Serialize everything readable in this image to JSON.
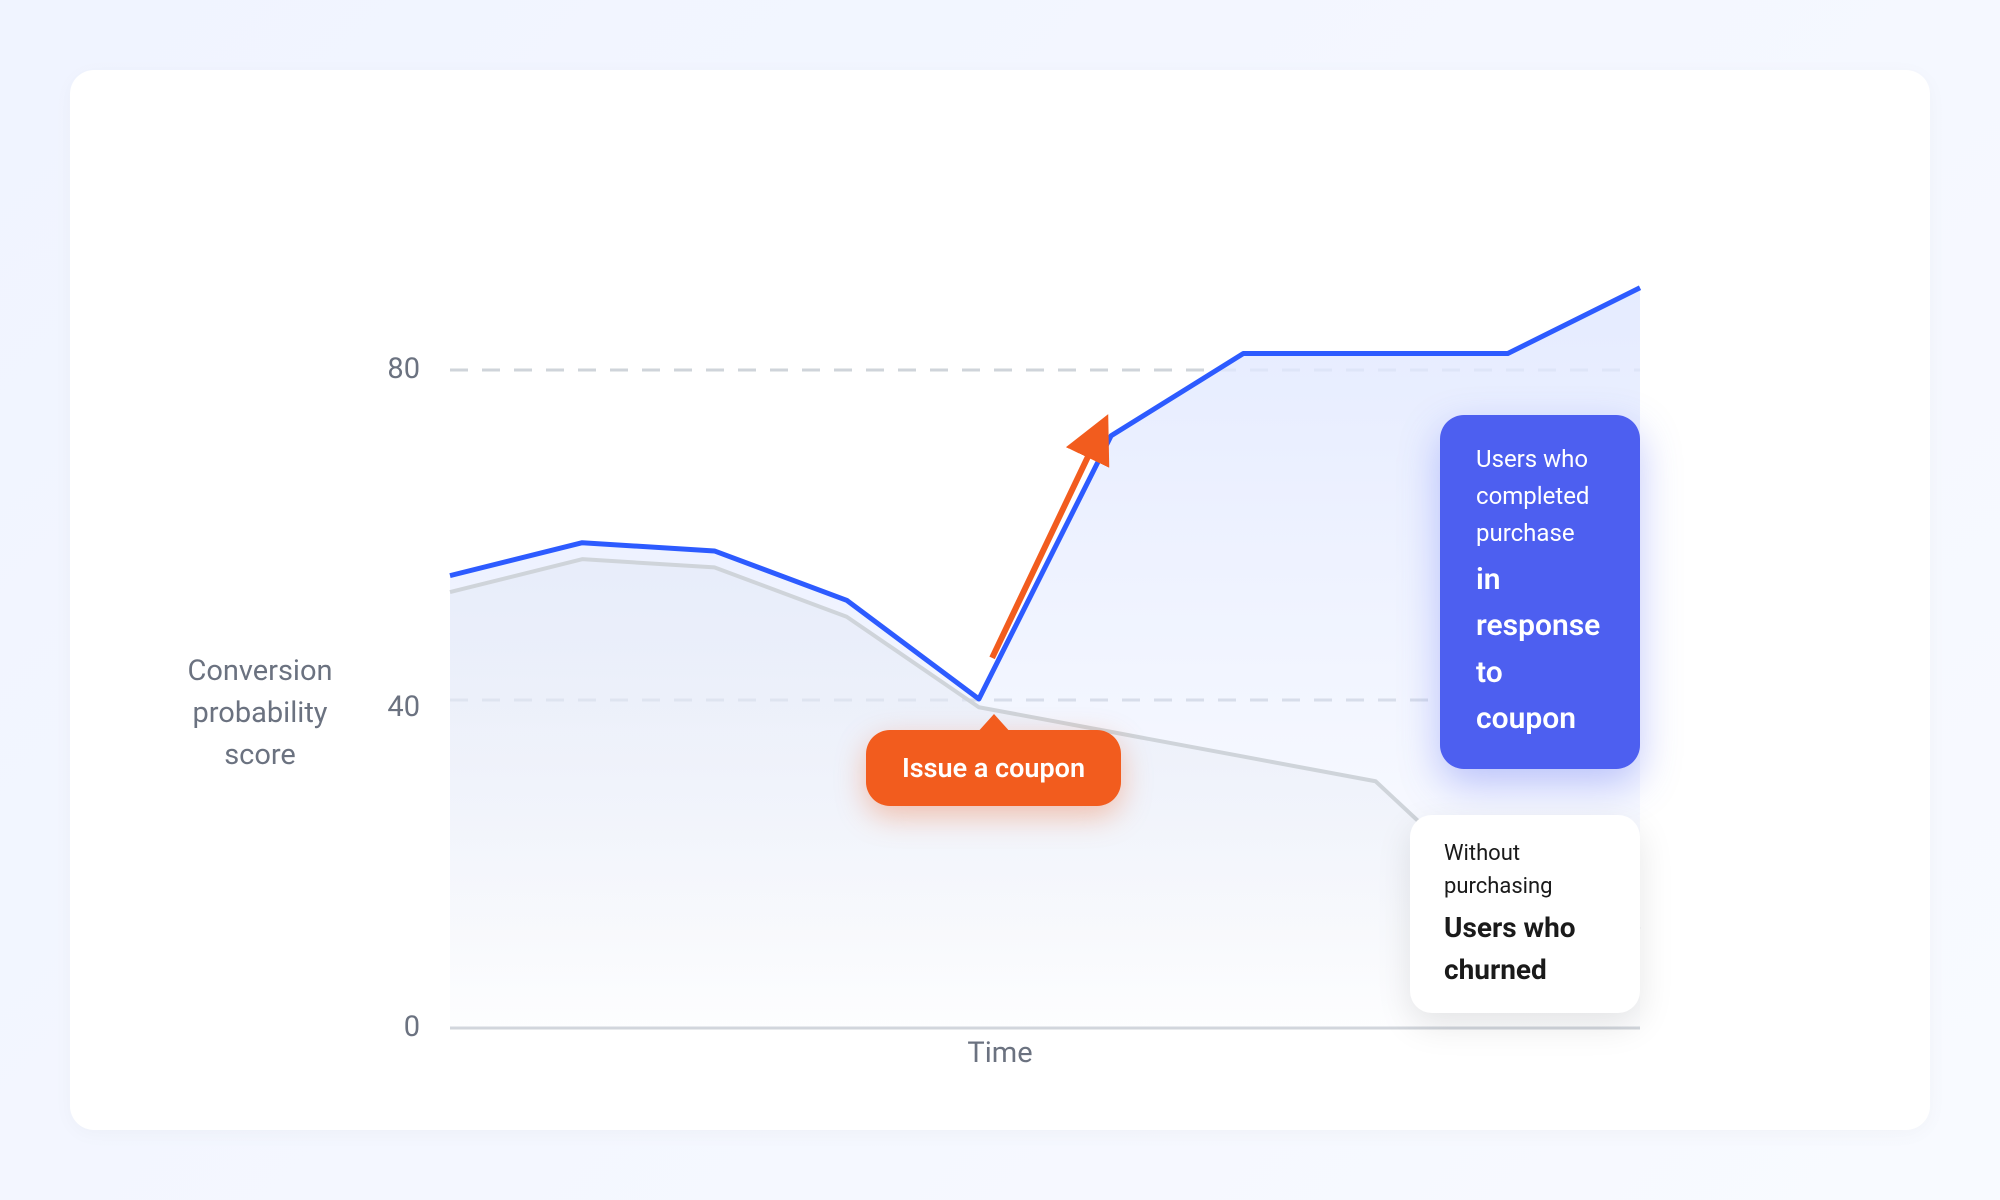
{
  "chart_data": {
    "type": "line",
    "xlabel": "Time",
    "ylabel": "Conversion probability score",
    "ylim": [
      0,
      100
    ],
    "y_ticks": [
      0,
      40,
      80
    ],
    "x": [
      0,
      1,
      2,
      3,
      4,
      5,
      6,
      7,
      8,
      9
    ],
    "series": [
      {
        "name": "Users who completed purchase in response to coupon",
        "color": "#2d5bff",
        "values": [
          55,
          59,
          58,
          52,
          40,
          72,
          82,
          82,
          82,
          90
        ]
      },
      {
        "name": "Users who churned without purchasing",
        "color": "#cfd4da",
        "values": [
          53,
          57,
          56,
          50,
          39,
          36,
          33,
          30,
          15,
          12
        ]
      }
    ],
    "annotations": [
      {
        "type": "action",
        "x": 4,
        "label": "Issue a coupon",
        "color": "#f25c1e"
      },
      {
        "type": "arrow",
        "from": [
          4.1,
          45
        ],
        "to": [
          4.9,
          72
        ],
        "color": "#f25c1e"
      }
    ],
    "legend": [
      {
        "line1": "Users who completed purchase",
        "line2": "in response to coupon",
        "style": "blue"
      },
      {
        "line1": "Without purchasing",
        "line2": "Users who churned",
        "style": "white"
      }
    ]
  }
}
